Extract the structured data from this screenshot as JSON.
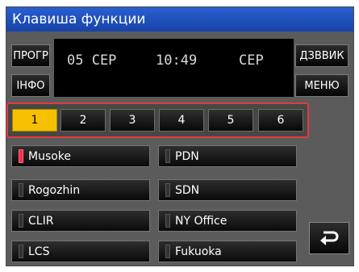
{
  "title": "Клавиша функции",
  "buttons": {
    "progr": "ПРОГР",
    "info": "ІНФО",
    "dzvvik": "ДЗВВИК",
    "menu": "МЕНЮ"
  },
  "display": {
    "date": "05 СЕР",
    "time": "10:49",
    "weekday": "СЕР"
  },
  "pages": [
    "1",
    "2",
    "3",
    "4",
    "5",
    "6"
  ],
  "active_page": "1",
  "function_keys_left": [
    {
      "label": "Musoke",
      "led": "on"
    },
    {
      "label": "Rogozhin",
      "led": "off"
    },
    {
      "label": "CLIR",
      "led": "off"
    },
    {
      "label": "LCS",
      "led": "off"
    }
  ],
  "function_keys_right": [
    {
      "label": "PDN",
      "led": "off"
    },
    {
      "label": "SDN",
      "led": "off"
    },
    {
      "label": "NY Office",
      "led": "off"
    },
    {
      "label": "Fukuoka",
      "led": "off"
    }
  ],
  "icons": {
    "enter": "enter-return-icon"
  },
  "colors": {
    "title_bar": "#1d4fc0",
    "active_page": "#f6c000",
    "led_on": "#ff2b4a",
    "selection_frame": "#e23b3b"
  }
}
